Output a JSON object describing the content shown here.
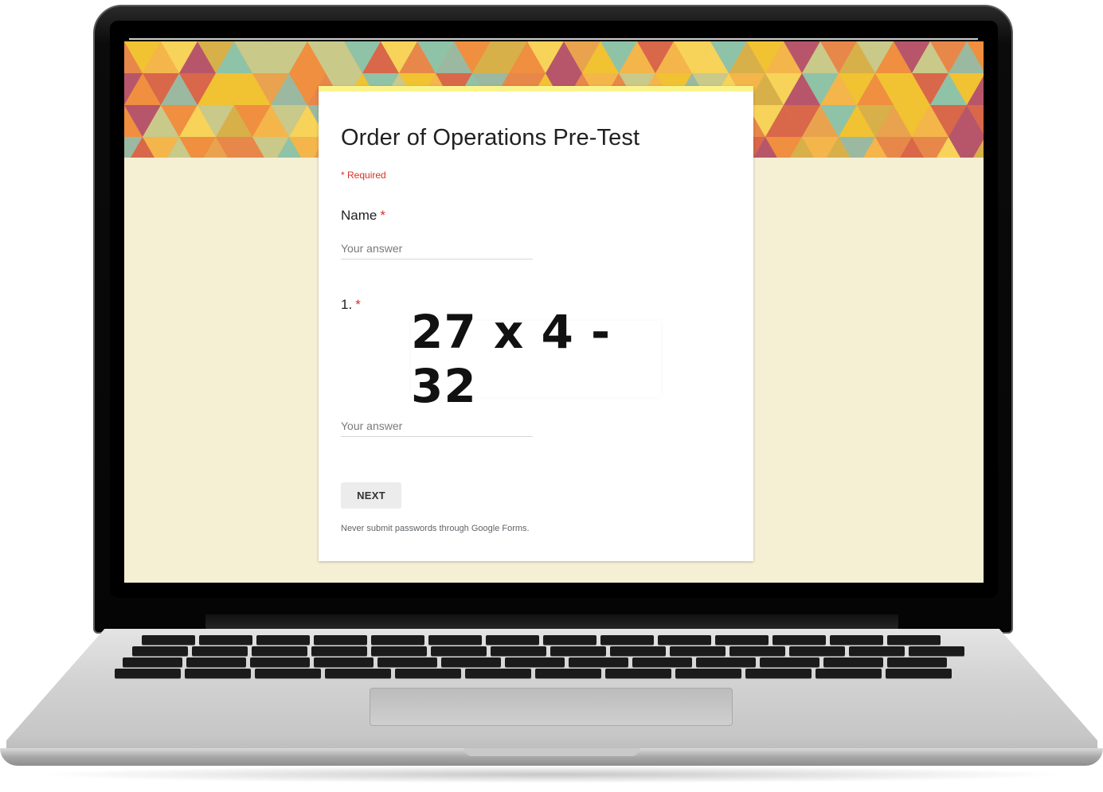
{
  "form": {
    "title": "Order of Operations Pre-Test",
    "required_note": "* Required",
    "questions": [
      {
        "label": "Name",
        "required_mark": "*",
        "placeholder": "Your answer"
      },
      {
        "label": "1.",
        "required_mark": "*",
        "image_expression": "27 x 4 - 32",
        "placeholder": "Your answer"
      }
    ],
    "next_label": "NEXT",
    "footer_note": "Never submit passwords through Google Forms."
  },
  "colors": {
    "card_accent": "#fbf48c",
    "page_background": "#f5efd4",
    "required_red": "#d93025"
  }
}
